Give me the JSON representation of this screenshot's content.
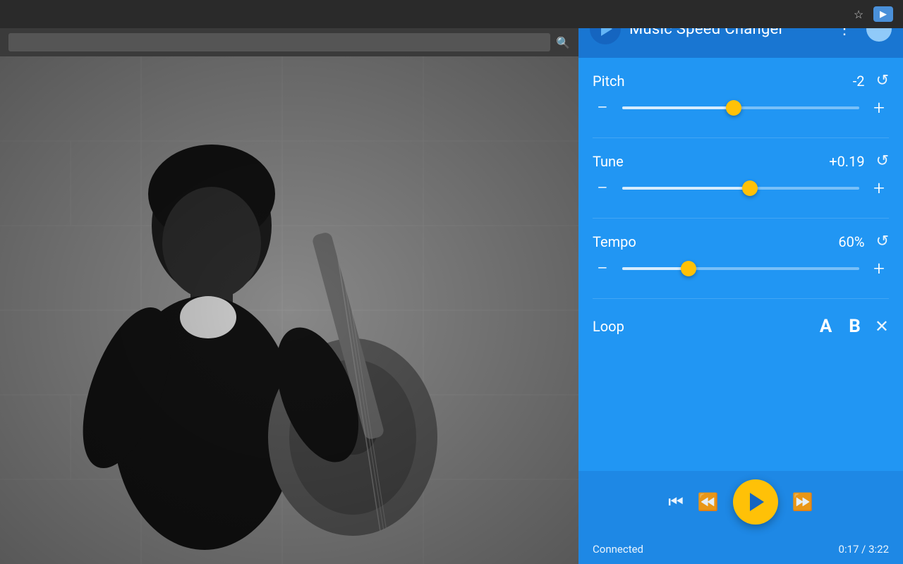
{
  "browser": {
    "title": "Music Speed Changer",
    "icons": {
      "star": "☆",
      "extension": "▶"
    }
  },
  "addressbar": {
    "placeholder": "",
    "search_icon": "🔍"
  },
  "panel": {
    "title": "Music Speed Changer",
    "menu_icon": "⋮",
    "pitch": {
      "label": "Pitch",
      "value": "-2",
      "thumb_pct": 47,
      "fill_pct": 47
    },
    "tune": {
      "label": "Tune",
      "value": "+0.19",
      "thumb_pct": 54,
      "fill_pct": 54
    },
    "tempo": {
      "label": "Tempo",
      "value": "60%",
      "thumb_pct": 28,
      "fill_pct": 28
    },
    "loop": {
      "label": "Loop",
      "btn_a": "A",
      "btn_b": "B",
      "close": "✕"
    },
    "transport": {
      "skip_back": "⏮",
      "rewind": "⏪",
      "play": "▶",
      "fast_forward": "⏩"
    },
    "status": {
      "connected": "Connected",
      "time": "0:17 / 3:22"
    }
  }
}
